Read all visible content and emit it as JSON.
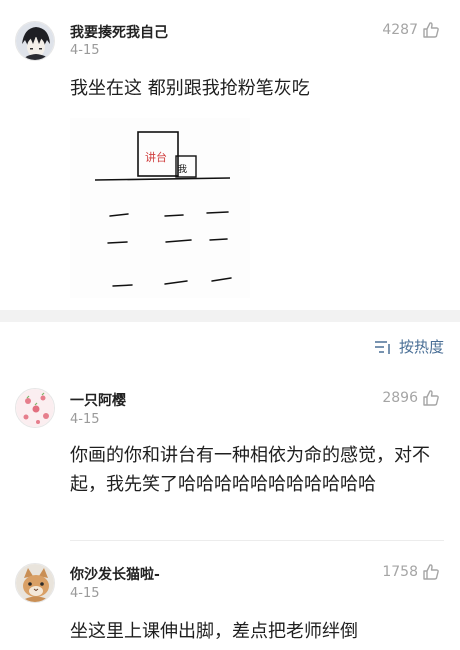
{
  "post": {
    "username": "我要揍死我自己",
    "date": "4-15",
    "likes": "4287",
    "text": "我坐在这 都别跟我抢粉笔灰吃",
    "drawing": {
      "podium_label": "讲台",
      "me_label": "我"
    }
  },
  "sort": {
    "label": "按热度",
    "icon": "sort-lines-icon"
  },
  "comments": [
    {
      "username": "一只阿樱",
      "date": "4-15",
      "likes": "2896",
      "text": "你画的你和讲台有一种相依为命的感觉，对不起，我先笑了哈哈哈哈哈哈哈哈哈哈哈"
    },
    {
      "username": "你沙发长猫啦-",
      "date": "4-15",
      "likes": "1758",
      "text": "坐这里上课伸出脚，差点把老师绊倒"
    }
  ],
  "colors": {
    "link": "#4a6f96",
    "muted": "#9a9a9a",
    "podium_text": "#d04040"
  }
}
